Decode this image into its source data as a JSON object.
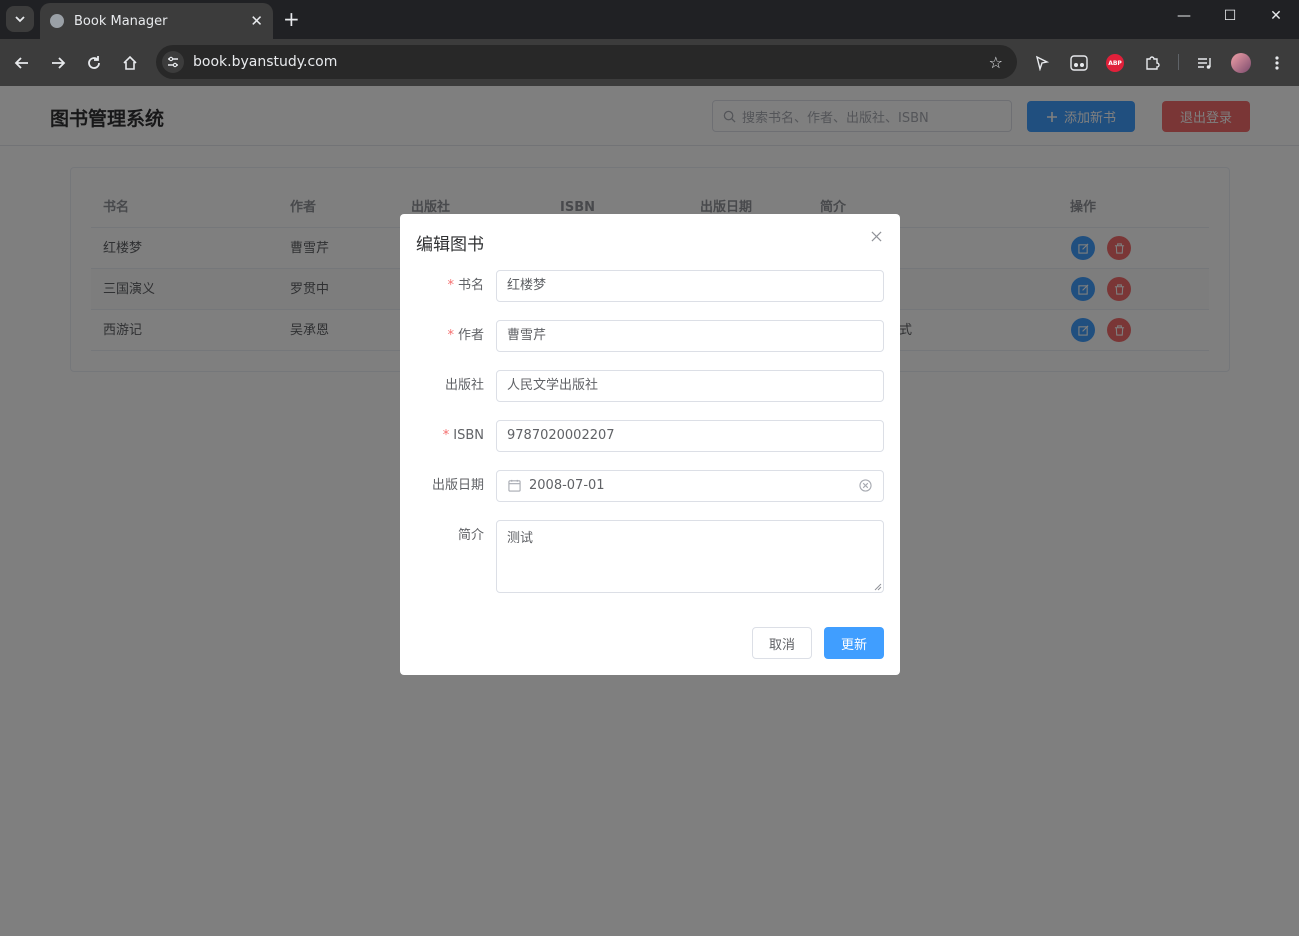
{
  "browser": {
    "tab_title": "Book Manager",
    "url": "book.byanstudy.com",
    "abp_label": "ABP"
  },
  "header": {
    "brand": "图书管理系统",
    "search_placeholder": "搜索书名、作者、出版社、ISBN",
    "add_button": "添加新书",
    "logout_button": "退出登录"
  },
  "table": {
    "columns": [
      "书名",
      "作者",
      "出版社",
      "ISBN",
      "出版日期",
      "简介",
      "操作"
    ],
    "rows": [
      {
        "title": "红楼梦",
        "author": "曹雪芹"
      },
      {
        "title": "三国演义",
        "author": "罗贯中"
      },
      {
        "title": "西游记",
        "author": "吴承恩",
        "intro_partial": "式"
      }
    ]
  },
  "dialog": {
    "title": "编辑图书",
    "required_mark": "*",
    "fields": {
      "name": {
        "label": "书名",
        "value": "红楼梦"
      },
      "author": {
        "label": "作者",
        "value": "曹雪芹"
      },
      "publisher": {
        "label": "出版社",
        "value": "人民文学出版社"
      },
      "isbn": {
        "label": "ISBN",
        "value": "9787020002207"
      },
      "date": {
        "label": "出版日期",
        "value": "2008-07-01"
      },
      "intro": {
        "label": "简介",
        "value": "测试"
      }
    },
    "cancel_button": "取消",
    "update_button": "更新"
  },
  "colors": {
    "primary": "#409eff",
    "danger": "#f56c6c",
    "overlay": "rgba(0,0,0,0.5)"
  }
}
